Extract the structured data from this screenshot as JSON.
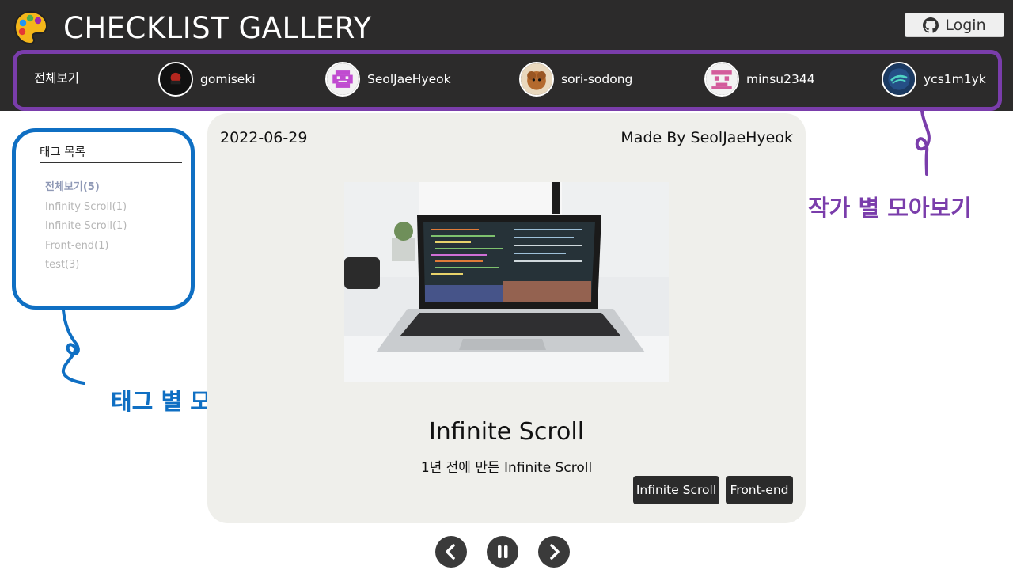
{
  "header": {
    "title": "CHECKLIST GALLERY",
    "login_label": "Login"
  },
  "authors": {
    "all_label": "전체보기",
    "items": [
      {
        "name": "gomiseki"
      },
      {
        "name": "SeolJaeHyeok"
      },
      {
        "name": "sori-sodong"
      },
      {
        "name": "minsu2344"
      },
      {
        "name": "ycs1m1yk"
      }
    ]
  },
  "tags": {
    "title": "태그 목록",
    "items": [
      {
        "label": "전체보기(5)"
      },
      {
        "label": "Infinity Scroll(1)"
      },
      {
        "label": "Infinite Scroll(1)"
      },
      {
        "label": "Front-end(1)"
      },
      {
        "label": "test(3)"
      }
    ]
  },
  "card": {
    "date": "2022-06-29",
    "author": "Made By SeolJaeHyeok",
    "title": "Infinite Scroll",
    "subtitle": "1년 전에 만든 Infinite Scroll",
    "tags": [
      "Infinite Scroll",
      "Front-end"
    ]
  },
  "annotations": {
    "author_label": "작가 별 모아보기",
    "tag_label": "태그 별 모아보기"
  },
  "colors": {
    "header_bg": "#2c2b2b",
    "author_outline": "#7a3dab",
    "tag_outline": "#0f6fc3",
    "card_bg": "#efefeb",
    "chip_bg": "#2b2b2b"
  },
  "icons": {
    "brand": "palette-icon",
    "login": "github-icon",
    "prev": "chevron-left-icon",
    "pause": "pause-icon",
    "next": "chevron-right-icon"
  }
}
